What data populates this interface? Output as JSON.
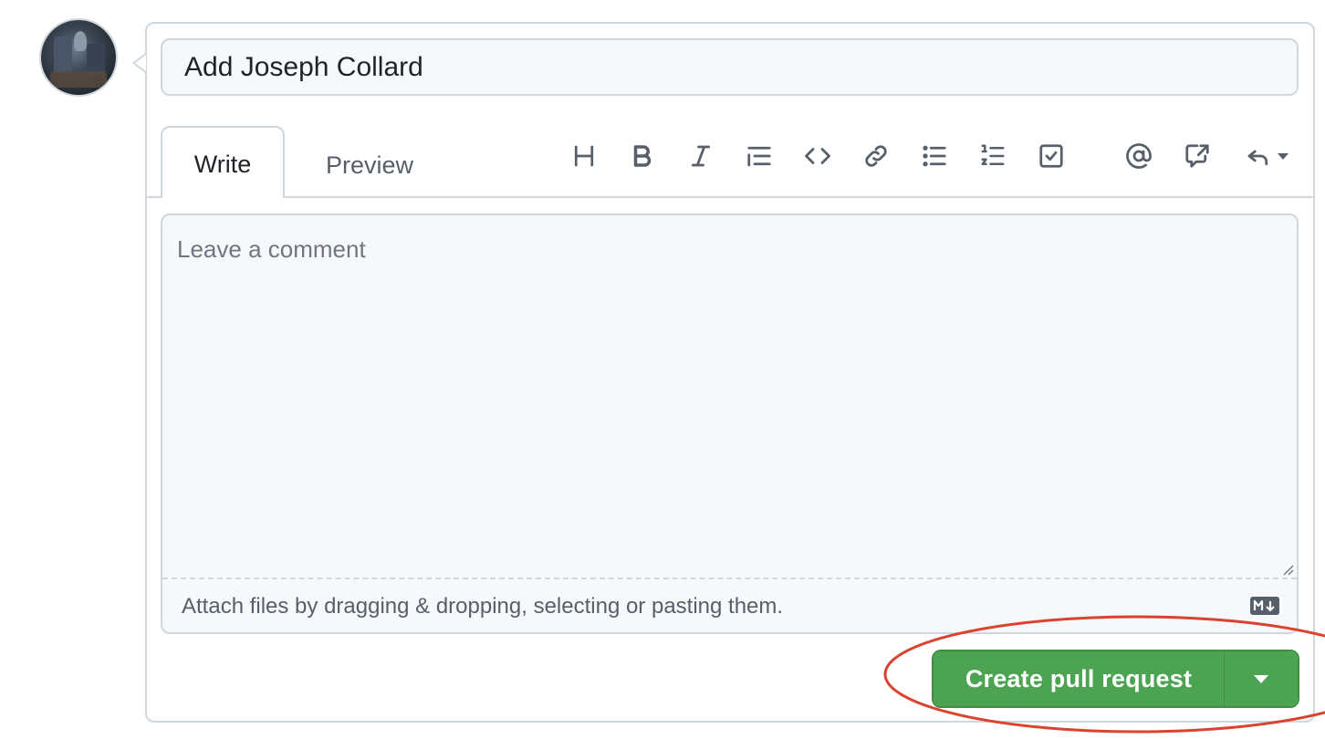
{
  "pr_form": {
    "title_value": "Add Joseph Collard",
    "tabs": [
      {
        "label": "Write",
        "active": true
      },
      {
        "label": "Preview",
        "active": false
      }
    ],
    "toolbar_icons": [
      "heading-icon",
      "bold-icon",
      "italic-icon",
      "quote-icon",
      "code-icon",
      "link-icon",
      "bulleted-list-icon",
      "numbered-list-icon",
      "task-list-icon",
      "mention-icon",
      "cross-reference-icon",
      "reply-icon"
    ],
    "comment_placeholder": "Leave a comment",
    "attach_hint": "Attach files by dragging & dropping, selecting or pasting them.",
    "markdown_badge": "markdown-icon"
  },
  "actions": {
    "create_label": "Create pull request",
    "dropdown_icon": "caret-down-icon"
  },
  "colors": {
    "primary_button": "#4ca352",
    "annotation": "#d9432f",
    "border": "#d0d7de",
    "field_background": "#f6f8fa"
  }
}
